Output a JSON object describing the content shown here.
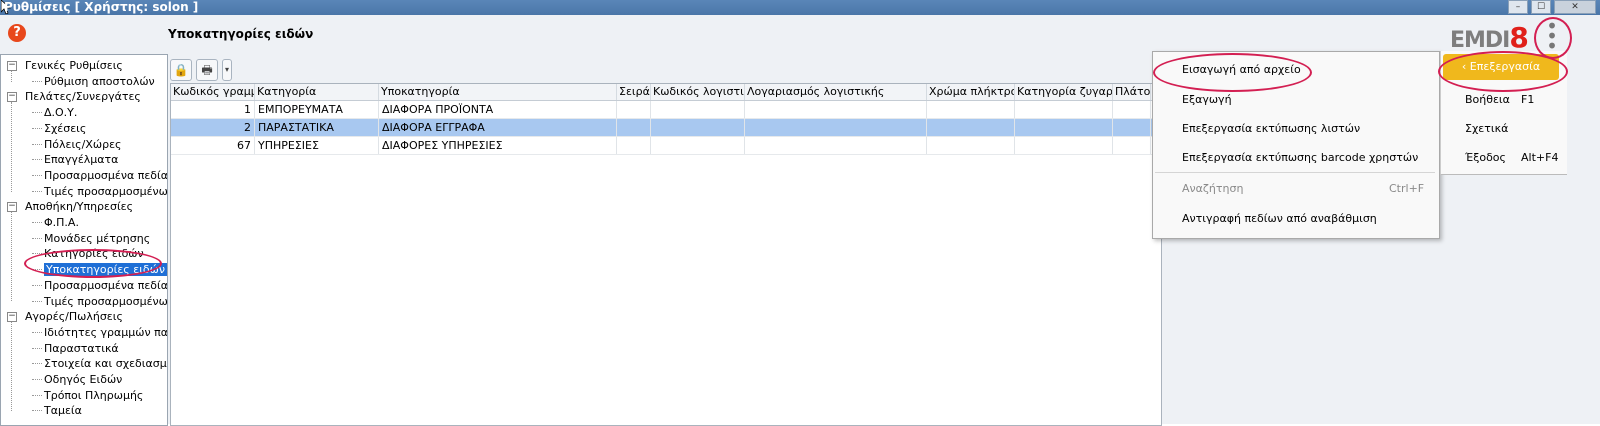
{
  "window": {
    "title": "Ρυθμίσεις  [ Χρήστης: solon ]",
    "controls": {
      "minimize": "–",
      "maximize": "☐",
      "close": "✕"
    }
  },
  "tree": {
    "items": [
      {
        "label": "Γενικές Ρυθμίσεις",
        "level": 0,
        "expander": "−"
      },
      {
        "label": "Ρύθμιση αποστολών",
        "level": 1
      },
      {
        "label": "Πελάτες/Συνεργάτες",
        "level": 0,
        "expander": "−"
      },
      {
        "label": "Δ.Ο.Υ.",
        "level": 1
      },
      {
        "label": "Σχέσεις",
        "level": 1
      },
      {
        "label": "Πόλεις/Χώρες",
        "level": 1
      },
      {
        "label": "Επαγγέλματα",
        "level": 1
      },
      {
        "label": "Προσαρμοσμένα πεδία",
        "level": 1
      },
      {
        "label": "Τιμές προσαρμοσμένων π",
        "level": 1
      },
      {
        "label": "Αποθήκη/Υπηρεσίες",
        "level": 0,
        "expander": "−"
      },
      {
        "label": "Φ.Π.Α.",
        "level": 1
      },
      {
        "label": "Μονάδες μέτρησης",
        "level": 1
      },
      {
        "label": "Κατηγορίες ειδών",
        "level": 1
      },
      {
        "label": "Υποκατηγορίες ειδών",
        "level": 1,
        "selected": true
      },
      {
        "label": "Προσαρμοσμένα πεδία",
        "level": 1
      },
      {
        "label": "Τιμές προσαρμοσμένων π",
        "level": 1
      },
      {
        "label": "Αγορές/Πωλήσεις",
        "level": 0,
        "expander": "−"
      },
      {
        "label": "Ιδιότητες γραμμών παρασ",
        "level": 1
      },
      {
        "label": "Παραστατικά",
        "level": 1
      },
      {
        "label": "Στοιχεία και σχεδιασμός π",
        "level": 1
      },
      {
        "label": "Οδηγός Ειδών",
        "level": 1
      },
      {
        "label": "Τρόποι Πληρωμής",
        "level": 1
      },
      {
        "label": "Ταμεία",
        "level": 1
      }
    ]
  },
  "main": {
    "section_title": "Υποκατηγορίες ειδών",
    "toolbar": {
      "lock_icon": "lock-icon",
      "print_icon": "printer-icon"
    }
  },
  "grid": {
    "columns": [
      "Κωδικός γραμμής",
      "Κατηγορία",
      "Υποκατηγορία",
      "Σειρά",
      "Κωδικός λογιστικής",
      "Λογαριασμός λογιστικής",
      "Χρώμα πλήκτρου",
      "Κατηγορία ζυγαριάς",
      "Πλάτος"
    ],
    "rows": [
      {
        "code": "1",
        "category": "ΕΜΠΟΡΕΥΜΑΤΑ",
        "subcategory": "ΔΙΑΦΟΡΑ ΠΡΟΪΟΝΤΑ",
        "selected": false
      },
      {
        "code": "2",
        "category": "ΠΑΡΑΣΤΑΤΙΚΑ",
        "subcategory": "ΔΙΑΦΟΡΑ ΕΓΓΡΑΦΑ",
        "selected": true
      },
      {
        "code": "67",
        "category": "ΥΠΗΡΕΣΙΕΣ",
        "subcategory": "ΔΙΑΦΟΡΕΣ ΥΠΗΡΕΣΙΕΣ",
        "selected": false
      }
    ]
  },
  "logo": {
    "text_gray": "EMDI",
    "text_red": "8"
  },
  "dropdown": {
    "items": [
      {
        "label": "Εισαγωγή από αρχείο",
        "shortcut": "",
        "disabled": false
      },
      {
        "label": "Εξαγωγή",
        "shortcut": "",
        "disabled": false
      },
      {
        "label": "Επεξεργασία εκτύπωσης λιστών",
        "shortcut": "",
        "disabled": false
      },
      {
        "label": "Επεξεργασία εκτύπωσης barcode χρηστών",
        "shortcut": "",
        "disabled": false
      },
      {
        "label": "Αναζήτηση",
        "shortcut": "Ctrl+F",
        "disabled": true
      },
      {
        "label": "Αντιγραφή πεδίων από αναβάθμιση",
        "shortcut": "",
        "disabled": false
      }
    ]
  },
  "right_menu": {
    "edit_label": "‹ Επεξεργασία",
    "items": [
      {
        "label": "Βοήθεια",
        "shortcut": "F1"
      },
      {
        "label": "Σχετικά",
        "shortcut": ""
      },
      {
        "label": "Έξοδος",
        "shortcut": "Alt+F4"
      }
    ]
  },
  "colors": {
    "accent_orange": "#f0b81c",
    "selection_blue": "#1f6fd6",
    "row_selected": "#a8c8f0",
    "highlight_ring": "#d31f52",
    "logo_red": "#e0201a"
  }
}
